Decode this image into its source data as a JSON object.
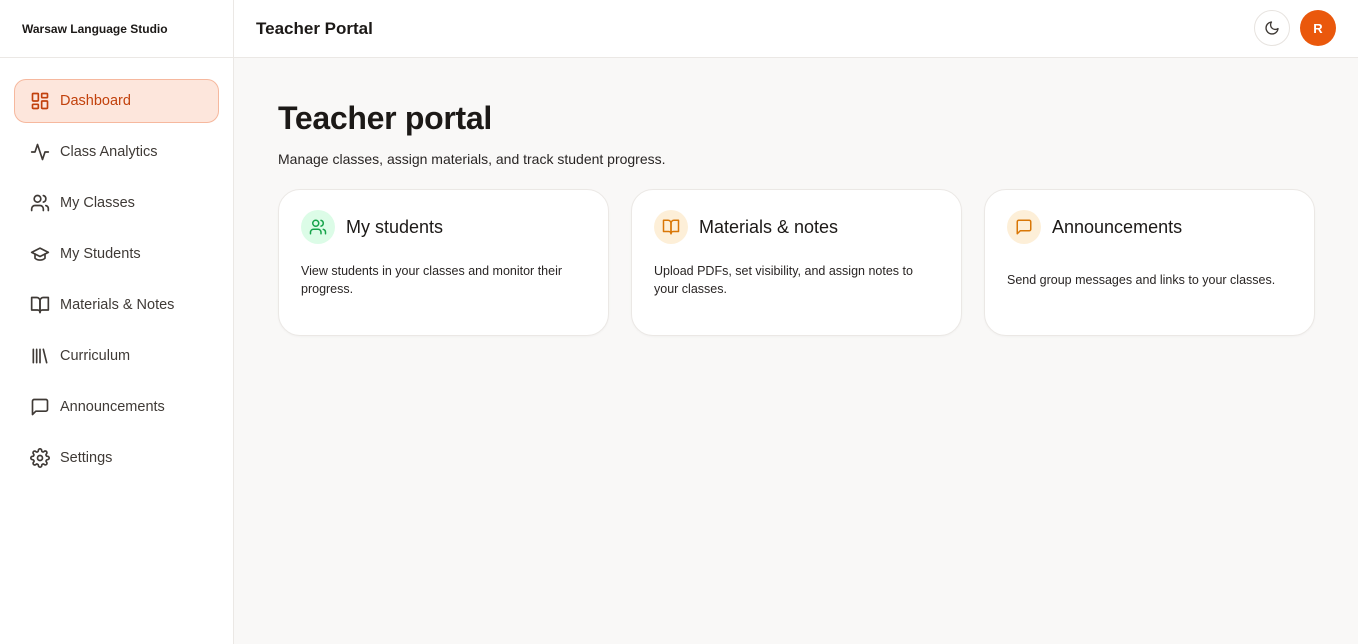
{
  "brand": "Warsaw Language Studio",
  "sidebar": {
    "items": [
      {
        "label": "Dashboard",
        "icon": "dashboard-icon",
        "active": true
      },
      {
        "label": "Class Analytics",
        "icon": "activity-icon"
      },
      {
        "label": "My Classes",
        "icon": "users-icon"
      },
      {
        "label": "My Students",
        "icon": "graduation-cap-icon"
      },
      {
        "label": "Materials & Notes",
        "icon": "book-open-icon"
      },
      {
        "label": "Curriculum",
        "icon": "library-icon"
      },
      {
        "label": "Announcements",
        "icon": "message-square-icon"
      },
      {
        "label": "Settings",
        "icon": "gear-icon"
      }
    ]
  },
  "header": {
    "title": "Teacher Portal",
    "avatar_initial": "R",
    "theme_icon": "moon-icon"
  },
  "main": {
    "title": "Teacher portal",
    "subtitle": "Manage classes, assign materials, and track student progress."
  },
  "cards": [
    {
      "title": "My students",
      "description": "View students in your classes and monitor their progress.",
      "icon": "users-icon",
      "icon_color": "#16a34a",
      "icon_bg": "#dcfce7"
    },
    {
      "title": "Materials & notes",
      "description": "Upload PDFs, set visibility, and assign notes to your classes.",
      "icon": "book-open-icon",
      "icon_color": "#d97706",
      "icon_bg": "#fdefd8"
    },
    {
      "title": "Announcements",
      "description": "Send group messages and links to your classes.",
      "icon": "message-square-icon",
      "icon_color": "#d97706",
      "icon_bg": "#fdefd8"
    }
  ],
  "colors": {
    "accent": "#ea580c",
    "active_bg": "#fde6dc",
    "active_text": "#c2410c"
  }
}
